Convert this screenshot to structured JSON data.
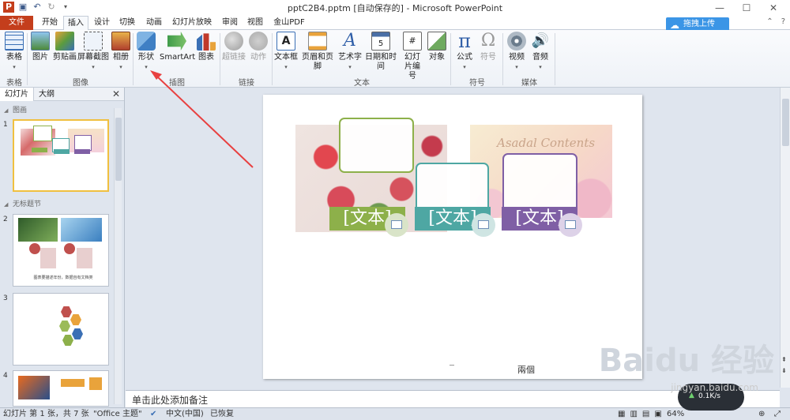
{
  "window": {
    "title": "pptC2B4.pptm [自动保存的] - Microsoft PowerPoint",
    "controls": [
      "—",
      "☐",
      "✕"
    ]
  },
  "tabs": [
    {
      "label": "文件",
      "kind": "file"
    },
    {
      "label": "开始"
    },
    {
      "label": "插入",
      "active": true
    },
    {
      "label": "设计"
    },
    {
      "label": "切换"
    },
    {
      "label": "动画"
    },
    {
      "label": "幻灯片放映"
    },
    {
      "label": "审阅"
    },
    {
      "label": "视图"
    },
    {
      "label": "金山PDF"
    }
  ],
  "upload_button": "拖拽上传",
  "ribbon": {
    "groups": [
      {
        "label": "表格"
      },
      {
        "label": "图像"
      },
      {
        "label": "插图"
      },
      {
        "label": "链接"
      },
      {
        "label": "文本"
      },
      {
        "label": "符号"
      },
      {
        "label": "媒体"
      }
    ],
    "buttons": [
      {
        "label": "表格",
        "dropdown": true
      },
      {
        "label": "图片"
      },
      {
        "label": "剪贴画"
      },
      {
        "label": "屏幕截图",
        "dropdown": true
      },
      {
        "label": "相册",
        "dropdown": true
      },
      {
        "label": "形状",
        "dropdown": true
      },
      {
        "label": "SmartArt"
      },
      {
        "label": "图表"
      },
      {
        "label": "超链接",
        "disabled": true
      },
      {
        "label": "动作",
        "disabled": true
      },
      {
        "label": "文本框",
        "dropdown": true
      },
      {
        "label": "页眉和页脚"
      },
      {
        "label": "艺术字",
        "dropdown": true
      },
      {
        "label": "日期和时间"
      },
      {
        "label": "幻灯片编号"
      },
      {
        "label": "对象"
      },
      {
        "label": "公式",
        "dropdown": true
      },
      {
        "label": "符号",
        "disabled": true
      },
      {
        "label": "视频",
        "dropdown": true
      },
      {
        "label": "音频",
        "dropdown": true
      }
    ]
  },
  "left_panel": {
    "tabs": [
      "幻灯片",
      "大纲"
    ],
    "sections": [
      "图画",
      "无标题节"
    ],
    "slides": [
      {
        "number": "1"
      },
      {
        "number": "2",
        "caption": "图表要描述年份，数据自有文档类"
      },
      {
        "number": "3"
      },
      {
        "number": "4"
      }
    ]
  },
  "slide": {
    "title_art": "Asadal Contents",
    "textboxes": [
      {
        "text": "[文本]",
        "color": "#8db04a"
      },
      {
        "text": "[文本]",
        "color": "#4ea7a3"
      },
      {
        "text": "[文本]",
        "color": "#7f5fa5"
      }
    ],
    "footer": "兩個"
  },
  "notes_placeholder": "单击此处添加备注",
  "status": {
    "slide_info": "幻灯片 第 1 张，共 7 张",
    "theme": "\"Office 主题\"",
    "language": "中文(中国)",
    "recovered": "已恢复",
    "zoom": "64%",
    "net_speed": "0.1K/s"
  },
  "watermark": {
    "brand": "Baidu 经验",
    "url": "jingyan.baidu.com"
  },
  "colors": {
    "file_tab": "#c43e1c",
    "accent_arrow": "#e84040",
    "upload": "#3b95e6"
  }
}
